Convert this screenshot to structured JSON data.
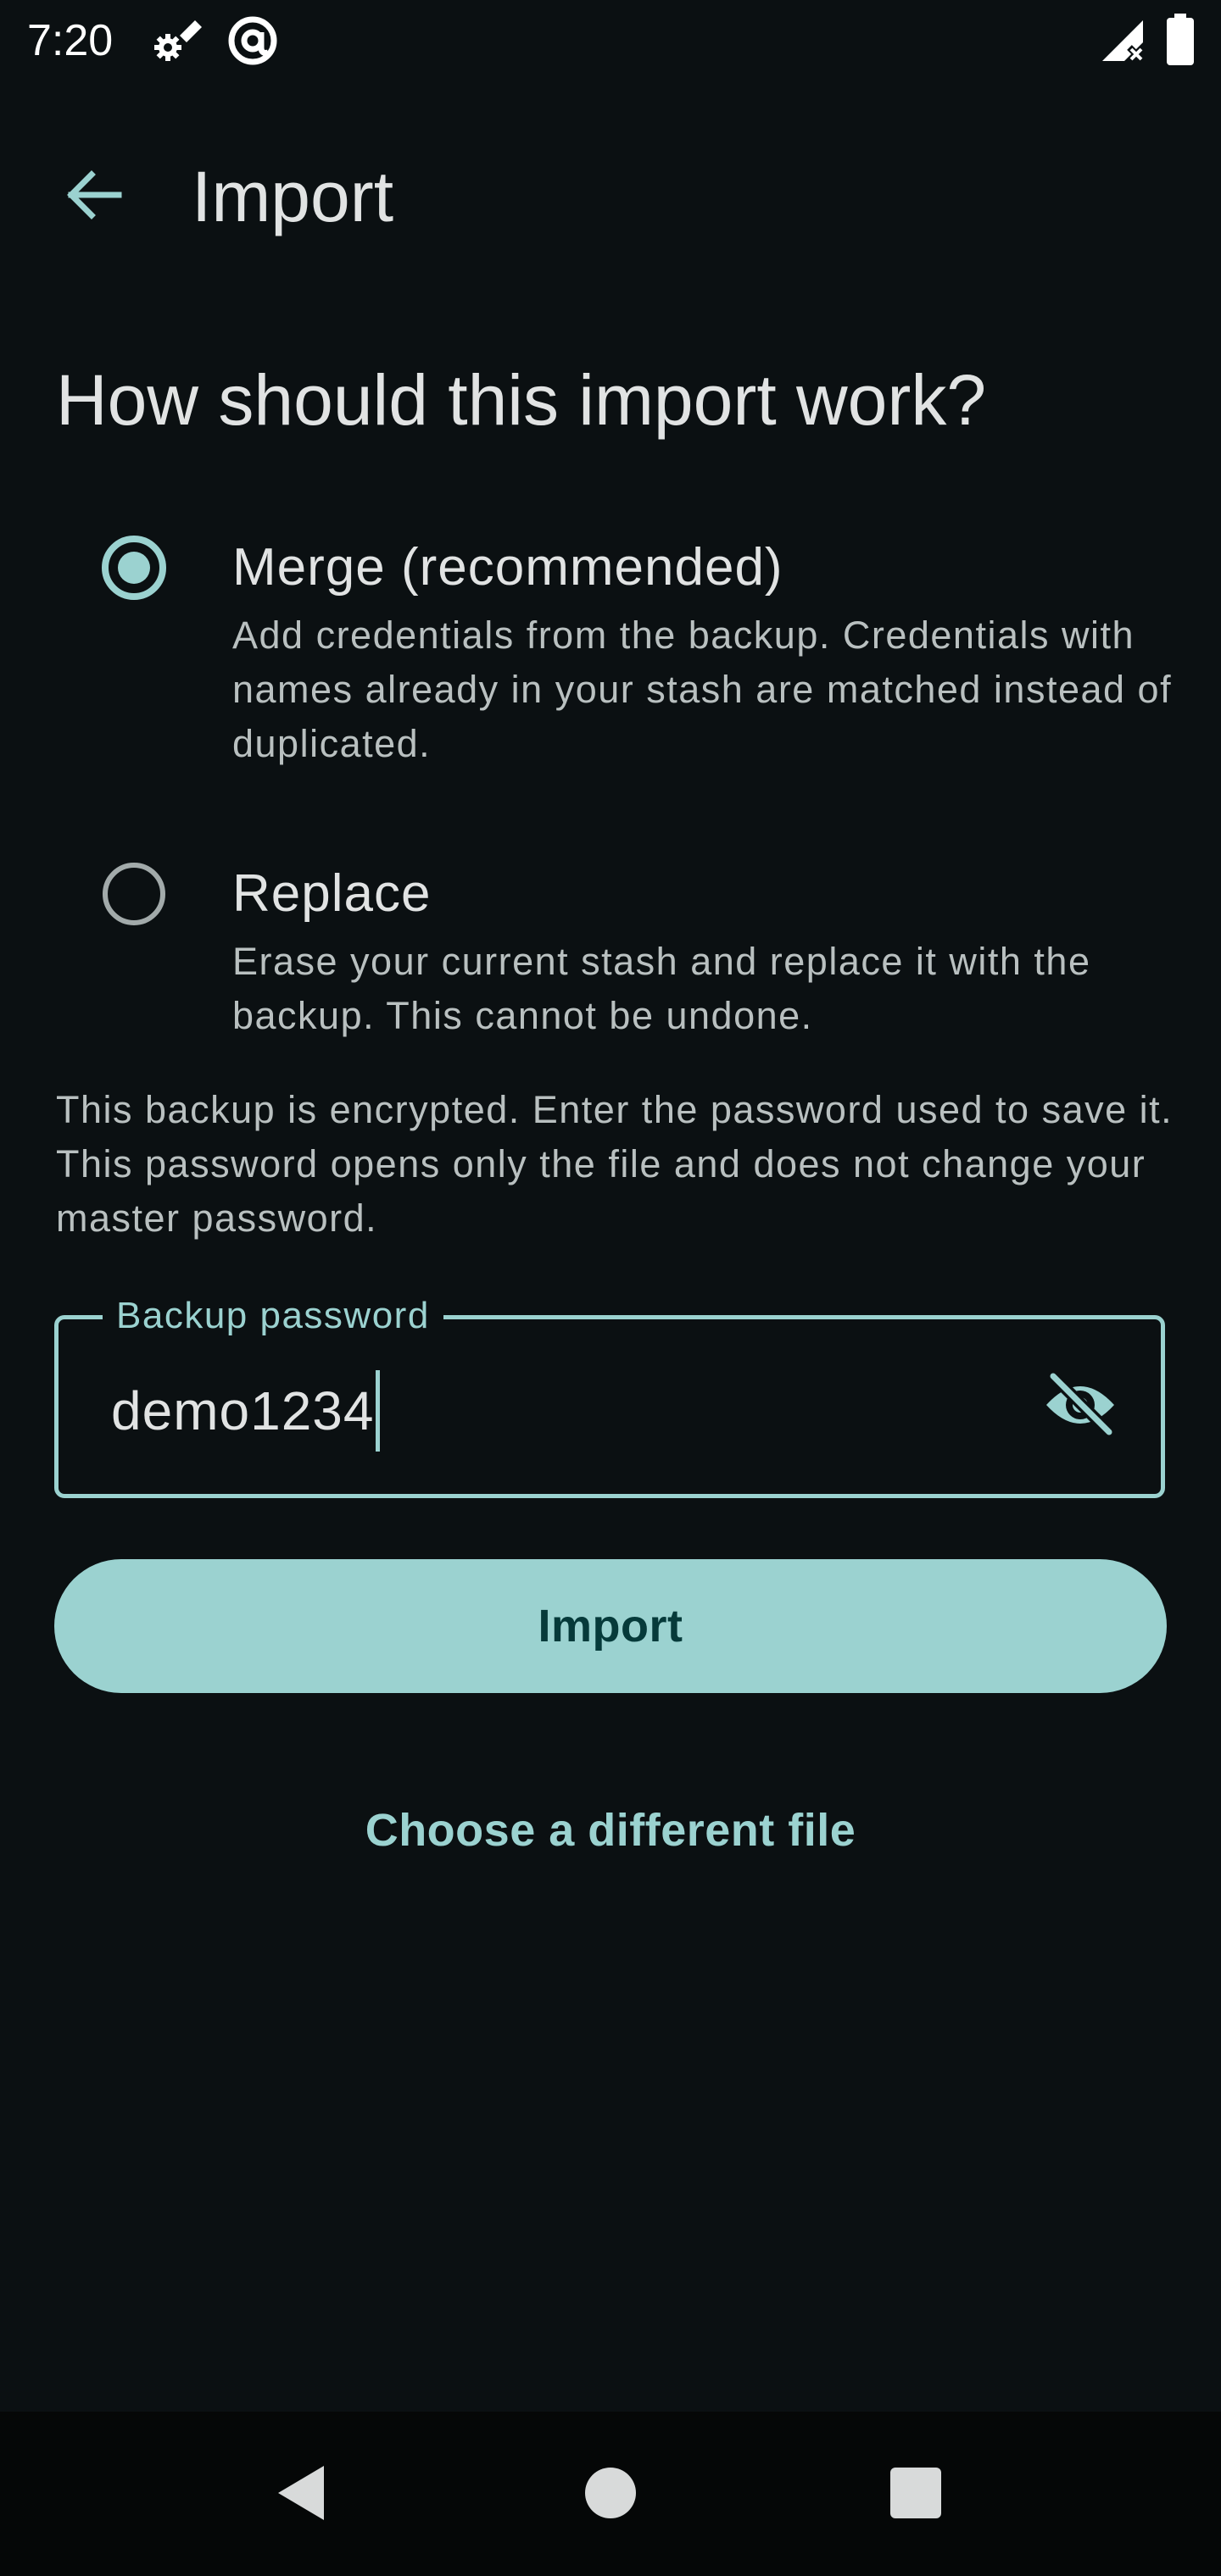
{
  "status_bar": {
    "time": "7:20",
    "icons": [
      "settings-sync-icon",
      "at-sign-icon",
      "signal-no-data-icon",
      "battery-icon"
    ]
  },
  "app_bar": {
    "title": "Import",
    "back_icon": "arrow-back-icon"
  },
  "heading": "How should this import work?",
  "options": [
    {
      "title": "Merge (recommended)",
      "description": "Add credentials from the backup. Credentials with names already in your stash are matched instead of duplicated.",
      "selected": true
    },
    {
      "title": "Replace",
      "description": "Erase your current stash and replace it with the backup. This cannot be undone.",
      "selected": false
    }
  ],
  "info_text": "This backup is encrypted. Enter the password used to save it. This password opens only the file and does not change your master password.",
  "password_field": {
    "label": "Backup password",
    "value": "demo1234",
    "toggle_icon": "visibility-off-icon"
  },
  "import_button_label": "Import",
  "choose_file_label": "Choose a different file",
  "colors": {
    "background": "#0b1012",
    "accent": "#9bd2d0",
    "on_accent": "#063a3a",
    "text_primary": "#e1e3e3",
    "text_secondary": "#b9c0c0"
  },
  "nav_bar": {
    "icons": [
      "back-triangle-icon",
      "home-circle-icon",
      "recents-square-icon"
    ]
  }
}
